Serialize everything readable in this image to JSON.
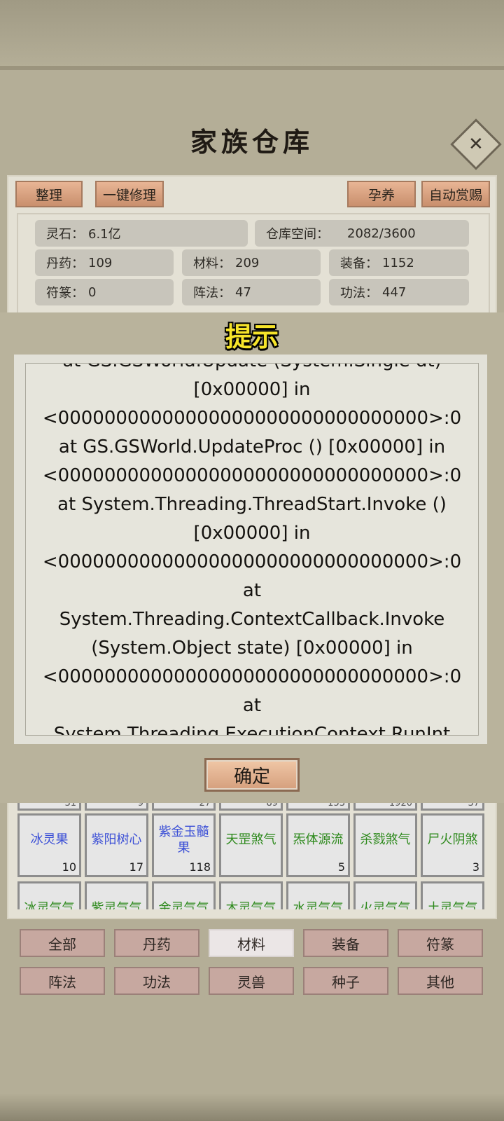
{
  "title": "家族仓库",
  "close_icon": "close-x-icon",
  "toolbar": {
    "sort": "整理",
    "repair_all": "一键修理",
    "nurture": "孕养",
    "auto_reward": "自动赏赐"
  },
  "stats": {
    "spirit_stone_label": "灵石：",
    "spirit_stone_value": "6.1亿",
    "storage_label": "仓库空间：",
    "storage_value": "2082/3600",
    "pills_label": "丹药：",
    "pills_value": "109",
    "materials_label": "材料：",
    "materials_value": "209",
    "equipment_label": "装备：",
    "equipment_value": "1152",
    "talismans_label": "符篆：",
    "talismans_value": "0",
    "formations_label": "阵法：",
    "formations_value": "47",
    "techniques_label": "功法：",
    "techniques_value": "447"
  },
  "dialog": {
    "title": "提示",
    "message": "at GS.GSWorld.Update (System.Single dt)\n[0x00000] in\n<00000000000000000000000000000000>:0\nat GS.GSWorld.UpdateProc () [0x00000] in\n<00000000000000000000000000000000>:0\nat System.Threading.ThreadStart.Invoke ()\n[0x00000] in\n<00000000000000000000000000000000>:0\nat\nSystem.Threading.ContextCallback.Invoke\n(System.Object state) [0x00000] in\n<00000000000000000000000000000000>:0\nat\nSystem.Threading.ExecutionContext.RunInt",
    "confirm": "确定"
  },
  "items_partial_top_counts": [
    "31",
    "9",
    "27",
    "89",
    "153",
    "1920",
    "37"
  ],
  "items": [
    {
      "name": "冰灵果",
      "count": "10",
      "color": "#3b4fd6"
    },
    {
      "name": "紫阳树心",
      "count": "17",
      "color": "#3b4fd6"
    },
    {
      "name": "紫金玉髓果",
      "count": "118",
      "color": "#3b4fd6"
    },
    {
      "name": "天罡煞气",
      "count": "",
      "color": "#2f8a1e"
    },
    {
      "name": "炁体源流",
      "count": "5",
      "color": "#2f8a1e"
    },
    {
      "name": "杀戮煞气",
      "count": "",
      "color": "#2f8a1e"
    },
    {
      "name": "尸火阴煞",
      "count": "3",
      "color": "#2f8a1e"
    }
  ],
  "items_partial_bottom": [
    "冰灵气气",
    "紫灵气气",
    "金灵气气",
    "木灵气气",
    "水灵气气",
    "火灵气气",
    "土灵气气"
  ],
  "tabs": [
    {
      "label": "全部",
      "active": false
    },
    {
      "label": "丹药",
      "active": false
    },
    {
      "label": "材料",
      "active": true
    },
    {
      "label": "装备",
      "active": false
    },
    {
      "label": "符篆",
      "active": false
    },
    {
      "label": "阵法",
      "active": false
    },
    {
      "label": "功法",
      "active": false
    },
    {
      "label": "灵兽",
      "active": false
    },
    {
      "label": "种子",
      "active": false
    },
    {
      "label": "其他",
      "active": false
    }
  ]
}
